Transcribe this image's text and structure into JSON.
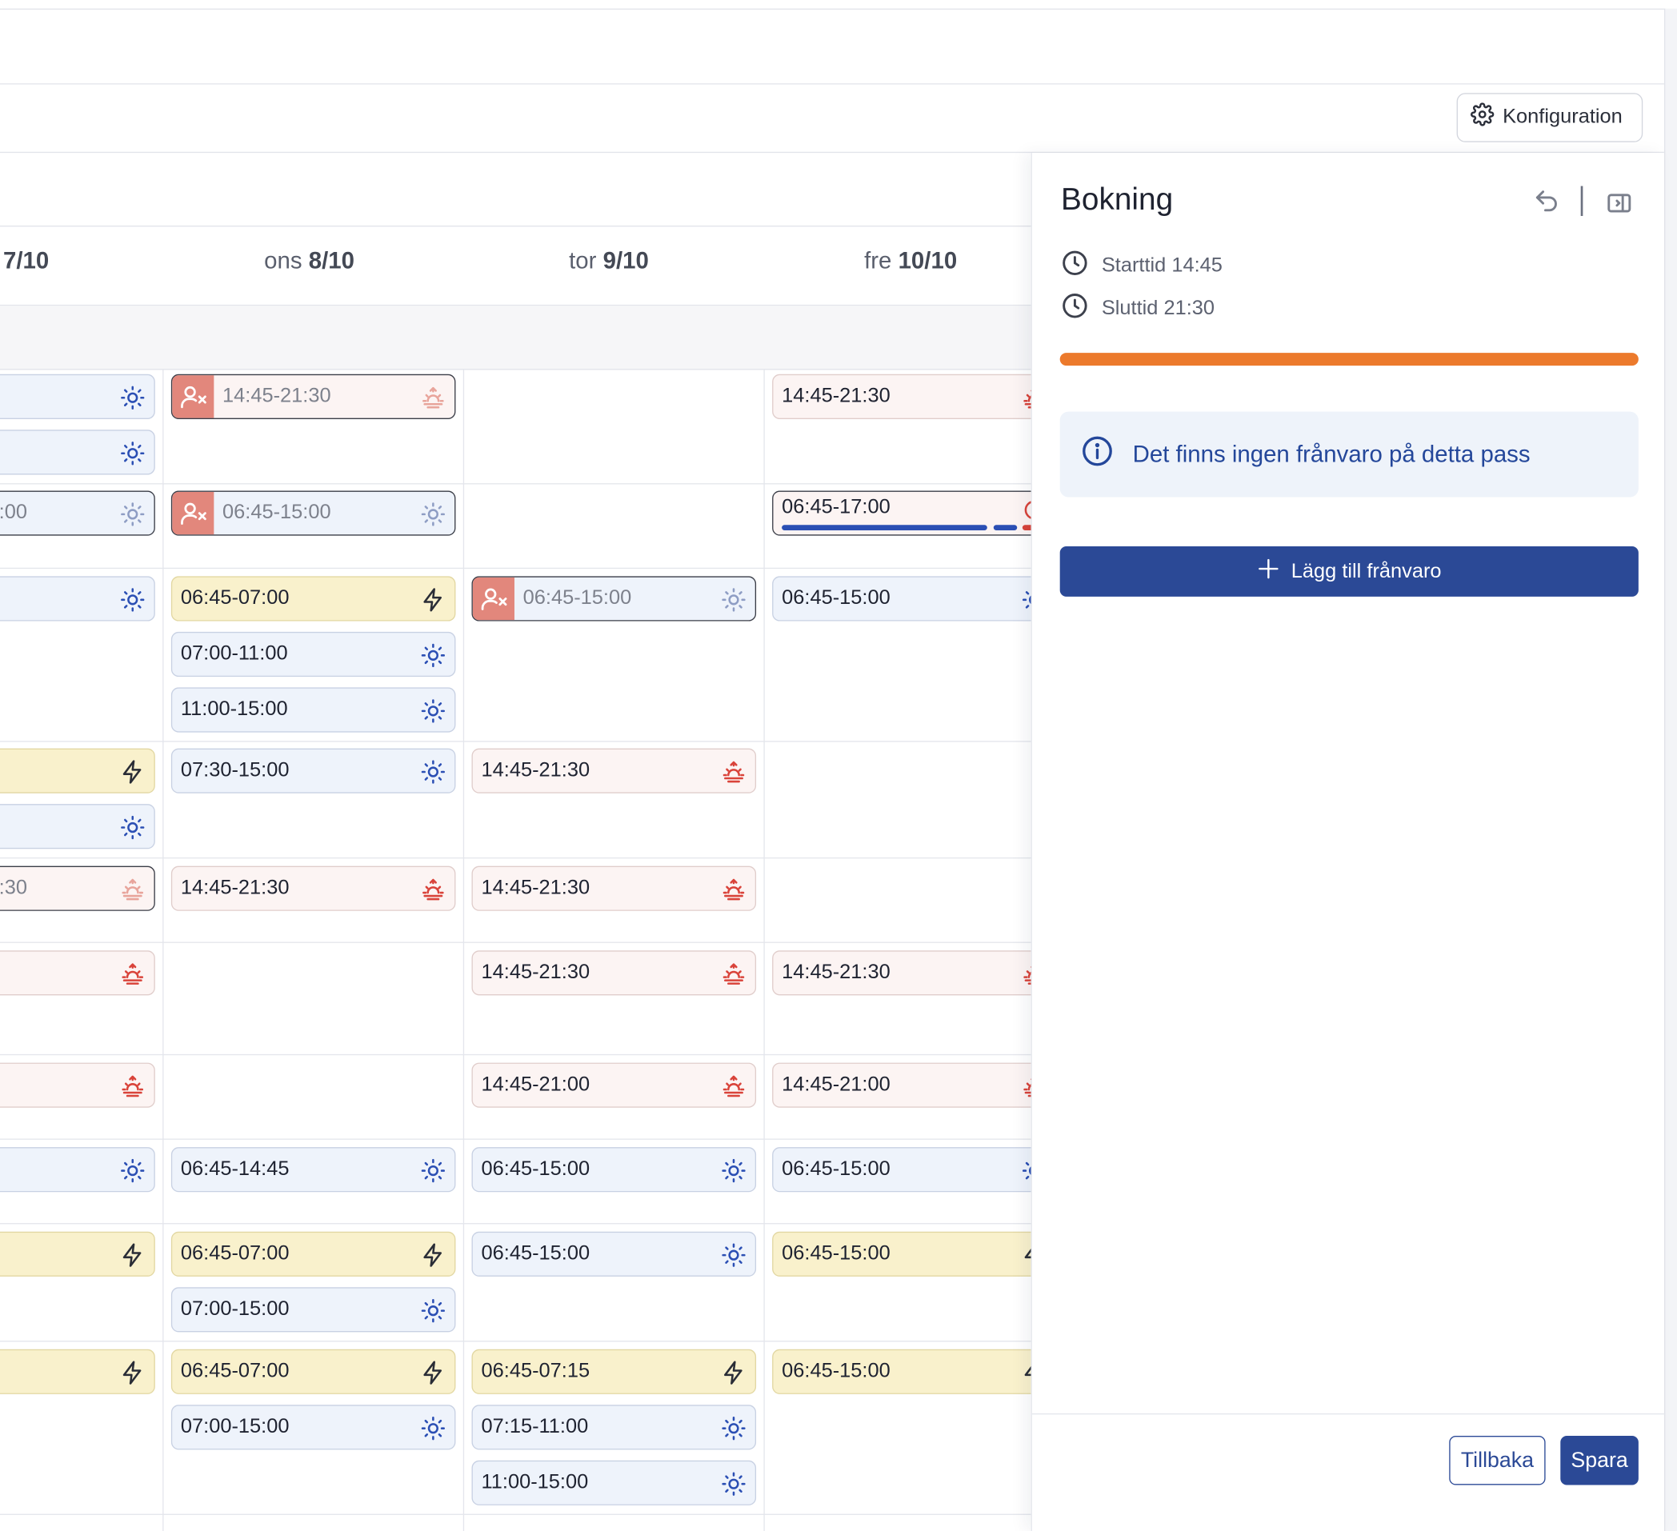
{
  "toolbar": {
    "config_label": "Konfiguration"
  },
  "days": [
    {
      "prefix": "",
      "date": "7/10"
    },
    {
      "prefix": "ons ",
      "date": "8/10"
    },
    {
      "prefix": "tor ",
      "date": "9/10"
    },
    {
      "prefix": "fre ",
      "date": "10/10"
    }
  ],
  "shifts": {
    "c0": [
      "",
      "",
      ":00",
      "",
      "",
      ":30",
      "",
      "",
      "",
      "",
      ""
    ],
    "r1": {
      "d8": "14:45-21:30",
      "d10": "14:45-21:30"
    },
    "r2": {
      "d8": "06:45-15:00",
      "d10": "06:45-17:00"
    },
    "r3": {
      "d8a": "06:45-07:00",
      "d8b": "07:00-11:00",
      "d8c": "11:00-15:00",
      "d9": "06:45-15:00",
      "d10": "06:45-15:00"
    },
    "r4": {
      "d8": "07:30-15:00",
      "d9": "14:45-21:30"
    },
    "r5": {
      "d8": "14:45-21:30",
      "d9": "14:45-21:30"
    },
    "r6": {
      "d9": "14:45-21:30",
      "d10": "14:45-21:30"
    },
    "r7": {
      "d9": "14:45-21:00",
      "d10": "14:45-21:00"
    },
    "r8": {
      "d8": "06:45-14:45",
      "d9": "06:45-15:00",
      "d10": "06:45-15:00"
    },
    "r9": {
      "d8a": "06:45-07:00",
      "d8b": "07:00-15:00",
      "d9": "06:45-15:00",
      "d10": "06:45-15:00"
    },
    "r10": {
      "d8a": "06:45-07:00",
      "d8b": "07:00-15:00",
      "d9a": "06:45-07:15",
      "d9b": "07:15-11:00",
      "d9c": "11:00-15:00",
      "d10": "06:45-15:00"
    }
  },
  "panel": {
    "title": "Bokning",
    "start_label": "Starttid 14:45",
    "end_label": "Sluttid 21:30",
    "progress": 1.0,
    "info_text": "Det finns ingen frånvaro på detta pass",
    "add_label": "Lägg till frånvaro",
    "back_label": "Tillbaka",
    "save_label": "Spara"
  },
  "colors": {
    "accent": "#2b4996",
    "progress": "#ec7a2c",
    "absence": "#e2877c",
    "day_shift": "#eef3fb",
    "evening_shift": "#fcf4f3",
    "extra_shift": "#f9f1cc"
  },
  "icons": [
    "sun-icon",
    "sunset-icon",
    "lightning-icon",
    "person-x-icon",
    "gear-icon",
    "clock-icon",
    "info-icon",
    "plus-icon",
    "undo-icon",
    "collapse-panel-icon",
    "timer-icon"
  ]
}
